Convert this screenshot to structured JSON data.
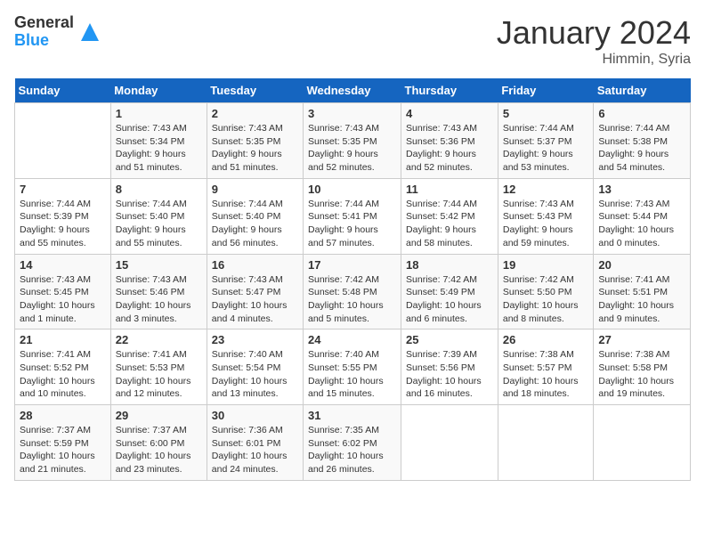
{
  "logo": {
    "general": "General",
    "blue": "Blue"
  },
  "title": "January 2024",
  "location": "Himmin, Syria",
  "headers": [
    "Sunday",
    "Monday",
    "Tuesday",
    "Wednesday",
    "Thursday",
    "Friday",
    "Saturday"
  ],
  "weeks": [
    [
      {
        "day": "",
        "sunrise": "",
        "sunset": "",
        "daylight": ""
      },
      {
        "day": "1",
        "sunrise": "Sunrise: 7:43 AM",
        "sunset": "Sunset: 5:34 PM",
        "daylight": "Daylight: 9 hours and 51 minutes."
      },
      {
        "day": "2",
        "sunrise": "Sunrise: 7:43 AM",
        "sunset": "Sunset: 5:35 PM",
        "daylight": "Daylight: 9 hours and 51 minutes."
      },
      {
        "day": "3",
        "sunrise": "Sunrise: 7:43 AM",
        "sunset": "Sunset: 5:35 PM",
        "daylight": "Daylight: 9 hours and 52 minutes."
      },
      {
        "day": "4",
        "sunrise": "Sunrise: 7:43 AM",
        "sunset": "Sunset: 5:36 PM",
        "daylight": "Daylight: 9 hours and 52 minutes."
      },
      {
        "day": "5",
        "sunrise": "Sunrise: 7:44 AM",
        "sunset": "Sunset: 5:37 PM",
        "daylight": "Daylight: 9 hours and 53 minutes."
      },
      {
        "day": "6",
        "sunrise": "Sunrise: 7:44 AM",
        "sunset": "Sunset: 5:38 PM",
        "daylight": "Daylight: 9 hours and 54 minutes."
      }
    ],
    [
      {
        "day": "7",
        "sunrise": "Sunrise: 7:44 AM",
        "sunset": "Sunset: 5:39 PM",
        "daylight": "Daylight: 9 hours and 55 minutes."
      },
      {
        "day": "8",
        "sunrise": "Sunrise: 7:44 AM",
        "sunset": "Sunset: 5:40 PM",
        "daylight": "Daylight: 9 hours and 55 minutes."
      },
      {
        "day": "9",
        "sunrise": "Sunrise: 7:44 AM",
        "sunset": "Sunset: 5:40 PM",
        "daylight": "Daylight: 9 hours and 56 minutes."
      },
      {
        "day": "10",
        "sunrise": "Sunrise: 7:44 AM",
        "sunset": "Sunset: 5:41 PM",
        "daylight": "Daylight: 9 hours and 57 minutes."
      },
      {
        "day": "11",
        "sunrise": "Sunrise: 7:44 AM",
        "sunset": "Sunset: 5:42 PM",
        "daylight": "Daylight: 9 hours and 58 minutes."
      },
      {
        "day": "12",
        "sunrise": "Sunrise: 7:43 AM",
        "sunset": "Sunset: 5:43 PM",
        "daylight": "Daylight: 9 hours and 59 minutes."
      },
      {
        "day": "13",
        "sunrise": "Sunrise: 7:43 AM",
        "sunset": "Sunset: 5:44 PM",
        "daylight": "Daylight: 10 hours and 0 minutes."
      }
    ],
    [
      {
        "day": "14",
        "sunrise": "Sunrise: 7:43 AM",
        "sunset": "Sunset: 5:45 PM",
        "daylight": "Daylight: 10 hours and 1 minute."
      },
      {
        "day": "15",
        "sunrise": "Sunrise: 7:43 AM",
        "sunset": "Sunset: 5:46 PM",
        "daylight": "Daylight: 10 hours and 3 minutes."
      },
      {
        "day": "16",
        "sunrise": "Sunrise: 7:43 AM",
        "sunset": "Sunset: 5:47 PM",
        "daylight": "Daylight: 10 hours and 4 minutes."
      },
      {
        "day": "17",
        "sunrise": "Sunrise: 7:42 AM",
        "sunset": "Sunset: 5:48 PM",
        "daylight": "Daylight: 10 hours and 5 minutes."
      },
      {
        "day": "18",
        "sunrise": "Sunrise: 7:42 AM",
        "sunset": "Sunset: 5:49 PM",
        "daylight": "Daylight: 10 hours and 6 minutes."
      },
      {
        "day": "19",
        "sunrise": "Sunrise: 7:42 AM",
        "sunset": "Sunset: 5:50 PM",
        "daylight": "Daylight: 10 hours and 8 minutes."
      },
      {
        "day": "20",
        "sunrise": "Sunrise: 7:41 AM",
        "sunset": "Sunset: 5:51 PM",
        "daylight": "Daylight: 10 hours and 9 minutes."
      }
    ],
    [
      {
        "day": "21",
        "sunrise": "Sunrise: 7:41 AM",
        "sunset": "Sunset: 5:52 PM",
        "daylight": "Daylight: 10 hours and 10 minutes."
      },
      {
        "day": "22",
        "sunrise": "Sunrise: 7:41 AM",
        "sunset": "Sunset: 5:53 PM",
        "daylight": "Daylight: 10 hours and 12 minutes."
      },
      {
        "day": "23",
        "sunrise": "Sunrise: 7:40 AM",
        "sunset": "Sunset: 5:54 PM",
        "daylight": "Daylight: 10 hours and 13 minutes."
      },
      {
        "day": "24",
        "sunrise": "Sunrise: 7:40 AM",
        "sunset": "Sunset: 5:55 PM",
        "daylight": "Daylight: 10 hours and 15 minutes."
      },
      {
        "day": "25",
        "sunrise": "Sunrise: 7:39 AM",
        "sunset": "Sunset: 5:56 PM",
        "daylight": "Daylight: 10 hours and 16 minutes."
      },
      {
        "day": "26",
        "sunrise": "Sunrise: 7:38 AM",
        "sunset": "Sunset: 5:57 PM",
        "daylight": "Daylight: 10 hours and 18 minutes."
      },
      {
        "day": "27",
        "sunrise": "Sunrise: 7:38 AM",
        "sunset": "Sunset: 5:58 PM",
        "daylight": "Daylight: 10 hours and 19 minutes."
      }
    ],
    [
      {
        "day": "28",
        "sunrise": "Sunrise: 7:37 AM",
        "sunset": "Sunset: 5:59 PM",
        "daylight": "Daylight: 10 hours and 21 minutes."
      },
      {
        "day": "29",
        "sunrise": "Sunrise: 7:37 AM",
        "sunset": "Sunset: 6:00 PM",
        "daylight": "Daylight: 10 hours and 23 minutes."
      },
      {
        "day": "30",
        "sunrise": "Sunrise: 7:36 AM",
        "sunset": "Sunset: 6:01 PM",
        "daylight": "Daylight: 10 hours and 24 minutes."
      },
      {
        "day": "31",
        "sunrise": "Sunrise: 7:35 AM",
        "sunset": "Sunset: 6:02 PM",
        "daylight": "Daylight: 10 hours and 26 minutes."
      },
      {
        "day": "",
        "sunrise": "",
        "sunset": "",
        "daylight": ""
      },
      {
        "day": "",
        "sunrise": "",
        "sunset": "",
        "daylight": ""
      },
      {
        "day": "",
        "sunrise": "",
        "sunset": "",
        "daylight": ""
      }
    ]
  ]
}
